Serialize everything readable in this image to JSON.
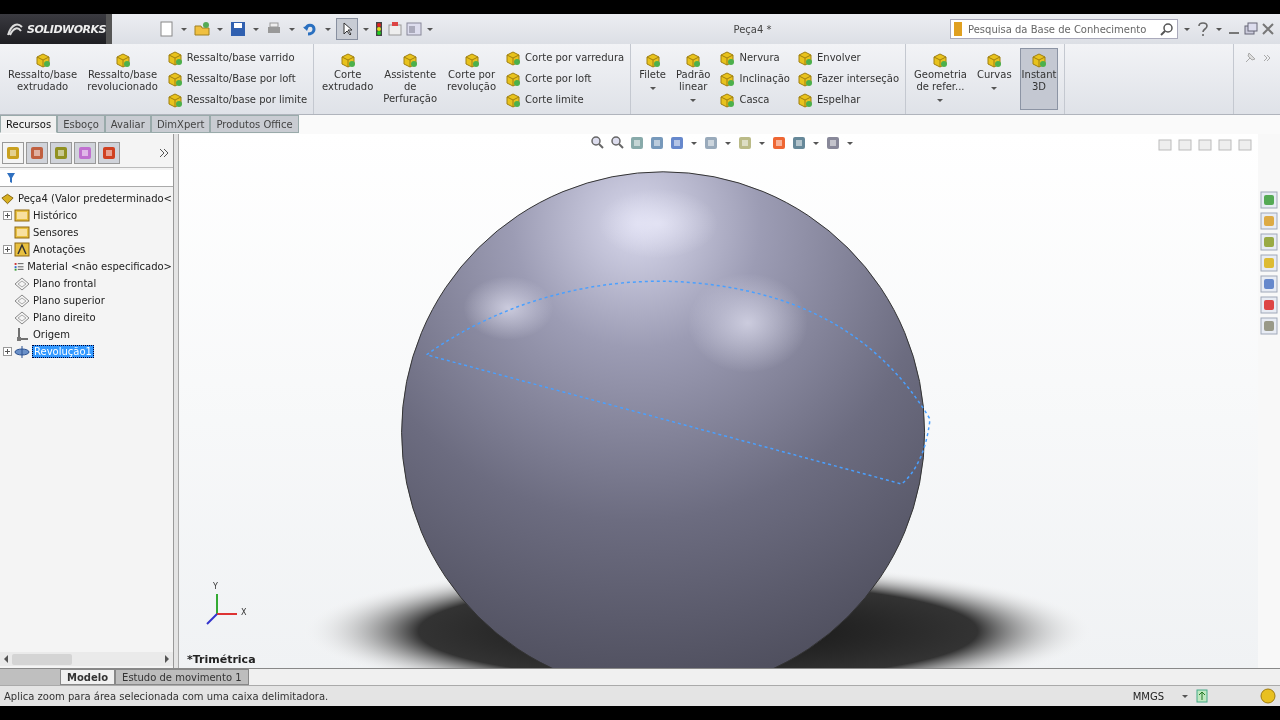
{
  "app": {
    "logo": "SOLIDWORKS",
    "document_title": "Peça4 *"
  },
  "search": {
    "placeholder": "Pesquisa da Base de Conhecimento"
  },
  "ribbon": [
    {
      "items": [
        {
          "kind": "large",
          "label": "Ressalto/base\nextrudado",
          "dropdown": false,
          "pressed": false
        },
        {
          "kind": "large",
          "label": "Ressalto/base\nrevolucionado",
          "dropdown": false,
          "pressed": false
        },
        {
          "kind": "stack",
          "entries": [
            "Ressalto/base varrido",
            "Ressalto/Base por loft",
            "Ressalto/base por limite"
          ]
        }
      ]
    },
    {
      "items": [
        {
          "kind": "large",
          "label": "Corte\nextrudado",
          "dropdown": false,
          "pressed": false
        },
        {
          "kind": "large",
          "label": "Assistente\nde\nPerfuração",
          "dropdown": false,
          "pressed": false
        },
        {
          "kind": "large",
          "label": "Corte por\nrevolução",
          "dropdown": false,
          "pressed": false
        },
        {
          "kind": "stack",
          "entries": [
            "Corte por varredura",
            "Corte por loft",
            "Corte limite"
          ]
        }
      ]
    },
    {
      "items": [
        {
          "kind": "large",
          "label": "Filete",
          "dropdown": true,
          "pressed": false
        },
        {
          "kind": "large",
          "label": "Padrão\nlinear",
          "dropdown": true,
          "pressed": false
        },
        {
          "kind": "stack",
          "entries": [
            "Nervura",
            "Inclinação",
            "Casca"
          ]
        },
        {
          "kind": "stack",
          "entries": [
            "Envolver",
            "Fazer interseção",
            "Espelhar"
          ]
        }
      ]
    },
    {
      "items": [
        {
          "kind": "large",
          "label": "Geometria\nde refer...",
          "dropdown": true,
          "pressed": false
        },
        {
          "kind": "large",
          "label": "Curvas",
          "dropdown": true,
          "pressed": false
        },
        {
          "kind": "large",
          "label": "Instant\n3D",
          "dropdown": false,
          "pressed": true
        }
      ]
    }
  ],
  "command_tabs": [
    {
      "label": "Recursos",
      "selected": true
    },
    {
      "label": "Esboço",
      "selected": false
    },
    {
      "label": "Avaliar",
      "selected": false
    },
    {
      "label": "DimXpert",
      "selected": false
    },
    {
      "label": "Produtos Office",
      "selected": false
    }
  ],
  "feature_tree": {
    "root": "Peça4  (Valor predeterminado<",
    "children": [
      {
        "label": "Histórico",
        "kind": "folder",
        "expandable": true,
        "selected": false
      },
      {
        "label": "Sensores",
        "kind": "folder",
        "expandable": false,
        "selected": false
      },
      {
        "label": "Anotações",
        "kind": "annotation",
        "expandable": true,
        "selected": false
      },
      {
        "label": "Material <não especificado>",
        "kind": "material",
        "expandable": false,
        "selected": false
      },
      {
        "label": "Plano frontal",
        "kind": "plane",
        "expandable": false,
        "selected": false
      },
      {
        "label": "Plano superior",
        "kind": "plane",
        "expandable": false,
        "selected": false
      },
      {
        "label": "Plano direito",
        "kind": "plane",
        "expandable": false,
        "selected": false
      },
      {
        "label": "Origem",
        "kind": "origin",
        "expandable": false,
        "selected": false
      },
      {
        "label": "Revolução1",
        "kind": "feature",
        "expandable": true,
        "selected": true
      }
    ]
  },
  "viewport": {
    "view_name": "*Trimétrica",
    "axis_labels": [
      "Y",
      "X"
    ]
  },
  "bottom_tabs": [
    {
      "label": "Modelo",
      "selected": true
    },
    {
      "label": "Estudo de movimento 1",
      "selected": false
    }
  ],
  "status_bar": {
    "message": "Aplica zoom para área selecionada com uma caixa delimitadora.",
    "units": "MMGS"
  }
}
